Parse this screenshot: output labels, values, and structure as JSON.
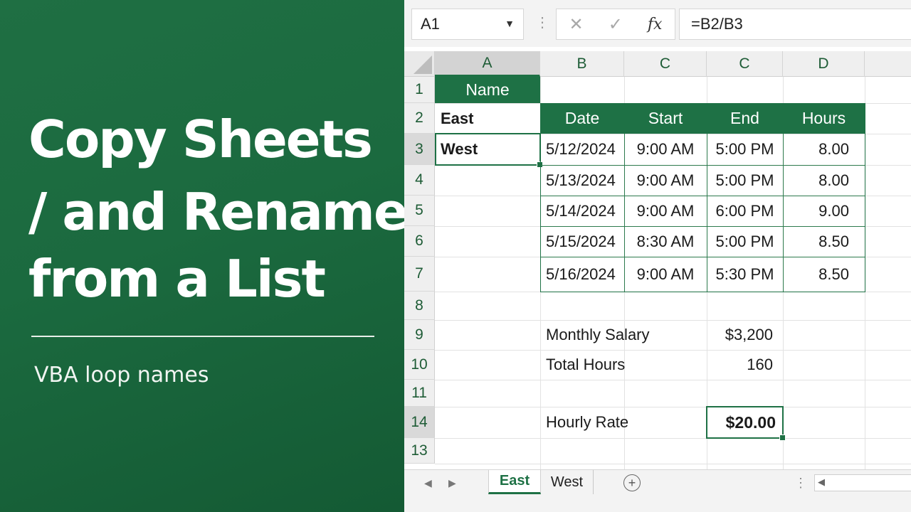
{
  "title": {
    "line1": "Copy Sheets",
    "line2": "/ and Rename /",
    "line3": "from a List",
    "subtitle": "VBA loop names"
  },
  "namebox": {
    "value": "A1",
    "dropdown_icon": "chevron-down-icon"
  },
  "formula": {
    "cancel_glyph": "✕",
    "enter_glyph": "✓",
    "fx_glyph": "fx",
    "value": "=B2/B3"
  },
  "columns": [
    "A",
    "B",
    "C",
    "C",
    "D"
  ],
  "rows": [
    "1",
    "2",
    "3",
    "4",
    "5",
    "6",
    "7",
    "8",
    "9",
    "10",
    "11",
    "14",
    "13"
  ],
  "list": {
    "header": "Name",
    "items": [
      "East",
      "West"
    ]
  },
  "timesheet": {
    "headers": [
      "Date",
      "Start",
      "End",
      "Hours"
    ],
    "rows": [
      [
        "5/12/2024",
        "9:00 AM",
        "5:00 PM",
        "8.00"
      ],
      [
        "5/13/2024",
        "9:00 AM",
        "5:00 PM",
        "8.00"
      ],
      [
        "5/14/2024",
        "9:00 AM",
        "6:00 PM",
        "9.00"
      ],
      [
        "5/15/2024",
        "8:30 AM",
        "5:00 PM",
        "8.50"
      ],
      [
        "5/16/2024",
        "9:00 AM",
        "5:30 PM",
        "8.50"
      ]
    ]
  },
  "summary": {
    "monthly_salary_label": "Monthly Salary",
    "monthly_salary_value": "$3,200",
    "total_hours_label": "Total Hours",
    "total_hours_value": "160",
    "hourly_rate_label": "Hourly Rate",
    "hourly_rate_value": "$20.00"
  },
  "tabs": {
    "prev_glyph": "◀",
    "next_glyph": "▶",
    "items": [
      "East",
      "West"
    ],
    "active": "East",
    "add_glyph": "+",
    "more_glyph": "⋮"
  },
  "colors": {
    "accent": "#1e7145",
    "panel": "#1b6a3f"
  }
}
